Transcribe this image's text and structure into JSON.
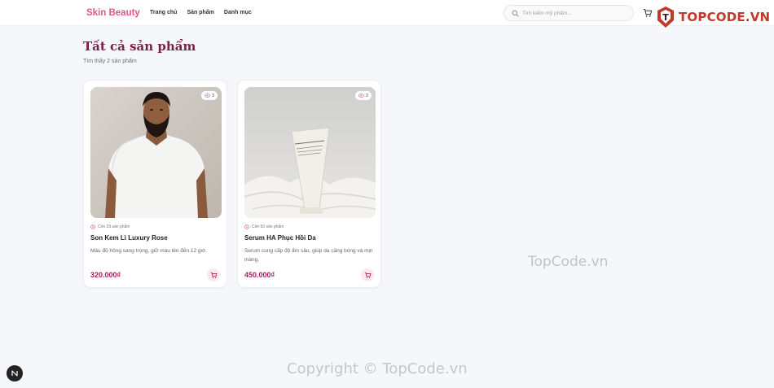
{
  "header": {
    "brand": "Skin Beauty",
    "nav": [
      {
        "label": "Trang chủ"
      },
      {
        "label": "Sản phẩm"
      },
      {
        "label": "Danh mục"
      }
    ],
    "search": {
      "placeholder": "Tìm kiếm mỹ phẩm...",
      "icon": "search-icon"
    },
    "cart_icon": "cart-icon"
  },
  "watermark_logo": {
    "text": "TOPCODE.VN"
  },
  "main": {
    "title": "Tất cả sản phẩm",
    "result_count": "Tìm thấy 2 sản phẩm"
  },
  "products": [
    {
      "views": "3",
      "stock": "Còn 29 sản phẩm",
      "name": "Son Kem Lì Luxury Rose",
      "description": "Màu đỏ hồng sang trọng, giữ màu lên đến 12 giờ.",
      "price": "320.000₫"
    },
    {
      "views": "2",
      "stock": "Còn 50 sản phẩm",
      "name": "Serum HA Phục Hồi Da",
      "description": "Serum cung cấp độ ẩm sâu, giúp da căng bóng và mịn màng.",
      "price": "450.000₫"
    }
  ],
  "watermarks": {
    "center": "TopCode.vn",
    "footer": "Copyright © TopCode.vn"
  },
  "colors": {
    "brand": "#e0578a",
    "title": "#7a1f47",
    "price": "#b01c5b",
    "background": "#f6f7fb"
  }
}
